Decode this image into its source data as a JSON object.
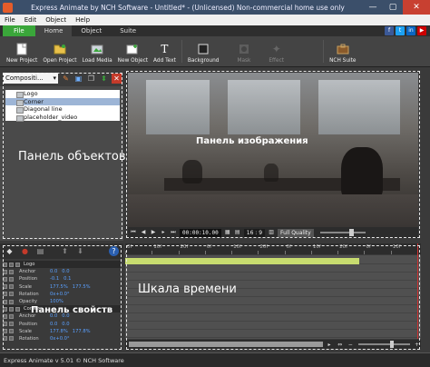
{
  "window": {
    "title": "Express Animate by NCH Software - Untitled* - (Unlicensed) Non-commercial home use only",
    "controls": [
      "—",
      "▢",
      "✕"
    ]
  },
  "menu": [
    "File",
    "Edit",
    "Object",
    "Help"
  ],
  "ribbon": {
    "tabs": [
      "File",
      "Home",
      "Object",
      "Suite"
    ],
    "active_tab": "Home",
    "social": [
      "f",
      "t",
      "in",
      "▶"
    ],
    "tools": [
      {
        "label": "New Project",
        "icon": "new-project-icon"
      },
      {
        "label": "Open Project",
        "icon": "open-folder-icon"
      },
      {
        "label": "Load Media",
        "icon": "load-media-icon"
      },
      {
        "label": "New Object",
        "icon": "new-object-icon"
      },
      {
        "label": "Add Text",
        "icon": "text-icon"
      },
      {
        "label": "Background",
        "icon": "background-icon"
      },
      {
        "label": "Mask",
        "icon": "mask-icon",
        "disabled": true
      },
      {
        "label": "Effect",
        "icon": "effect-icon",
        "disabled": true
      },
      {
        "label": "NCH Suite",
        "icon": "suite-icon"
      }
    ]
  },
  "objects_panel": {
    "selector": "Compositi...",
    "tree": [
      "Logo",
      "Corner",
      "Diagonal line",
      "placeholder_video"
    ],
    "selected": "Corner",
    "overlay": "Панель объектов"
  },
  "preview": {
    "overlay": "Панель изображения",
    "time": "00:00:10.00",
    "ratio": "16 : 9",
    "quality": "Full Quality",
    "zoom_level": 0.65
  },
  "properties": {
    "overlay": "Панель свойств",
    "groups": [
      {
        "name": "Logo",
        "rows": [
          {
            "name": "Anchor",
            "values": [
              "0.0",
              "0.0"
            ]
          },
          {
            "name": "Position",
            "values": [
              "-0.1",
              "0.1"
            ]
          },
          {
            "name": "Scale",
            "values": [
              "177.5%",
              "177.5%"
            ]
          },
          {
            "name": "Rotation",
            "values": [
              "0x+0.0°"
            ]
          },
          {
            "name": "Opacity",
            "values": [
              "100%"
            ]
          }
        ]
      },
      {
        "name": "Corner",
        "rows": [
          {
            "name": "Anchor",
            "values": [
              "0.0",
              "0.0"
            ]
          },
          {
            "name": "Position",
            "values": [
              "0.0",
              "0.0"
            ]
          },
          {
            "name": "Scale",
            "values": [
              "177.8%",
              "177.8%"
            ]
          },
          {
            "name": "Rotation",
            "values": [
              "0x+0.0°"
            ]
          }
        ]
      }
    ]
  },
  "timeline": {
    "overlay": "Шкала времени",
    "ticks": [
      "0f",
      "10f",
      "20f",
      "0f",
      "10f",
      "20f",
      "0f",
      "10f",
      "20f",
      "0f",
      "10f"
    ],
    "clip_fraction": 0.79
  },
  "status": "Express Animate v 5.01 © NCH Software"
}
